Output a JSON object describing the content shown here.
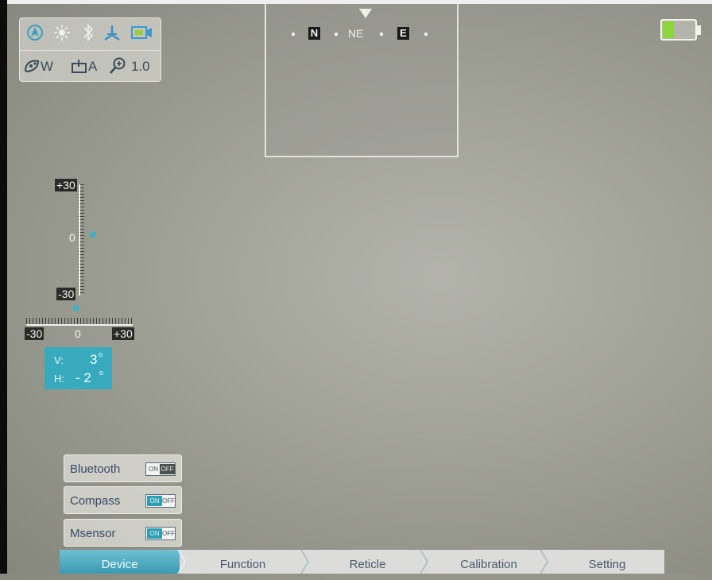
{
  "status": {
    "icons_row1": [
      "navigation-icon",
      "brightness-icon",
      "bluetooth-icon",
      "compass-icon",
      "recording-icon"
    ],
    "white_balance": "W",
    "shutter_mode": "A",
    "zoom": "1.0"
  },
  "compass": {
    "left_box": "N",
    "center": "NE",
    "right_box": "E"
  },
  "battery": {
    "level": 0.35,
    "fill_color": "#8dd63c"
  },
  "vertical_gauge": {
    "top_label": "+30",
    "mid_label": "0",
    "bottom_label": "-30",
    "value": 3
  },
  "horizontal_gauge": {
    "left_label": "-30",
    "mid_label": "0",
    "right_label": "+30",
    "value": -2
  },
  "tilt": {
    "v_label": "V:",
    "v_value": "3",
    "v_unit": "o",
    "h_label": "H:",
    "h_value": "- 2",
    "h_unit": "o",
    "box_color": "#38aabe"
  },
  "toggles": [
    {
      "label": "Bluetooth",
      "state": "off",
      "on_text": "ON",
      "off_text": "OFF"
    },
    {
      "label": "Compass",
      "state": "on",
      "on_text": "ON",
      "off_text": "OFF"
    },
    {
      "label": "Msensor",
      "state": "on",
      "on_text": "ON",
      "off_text": "OFF"
    }
  ],
  "menu": {
    "tabs": [
      "Device",
      "Function",
      "Reticle",
      "Calibration",
      "Setting"
    ],
    "active": "Device",
    "accent": "#3a9ab2"
  }
}
